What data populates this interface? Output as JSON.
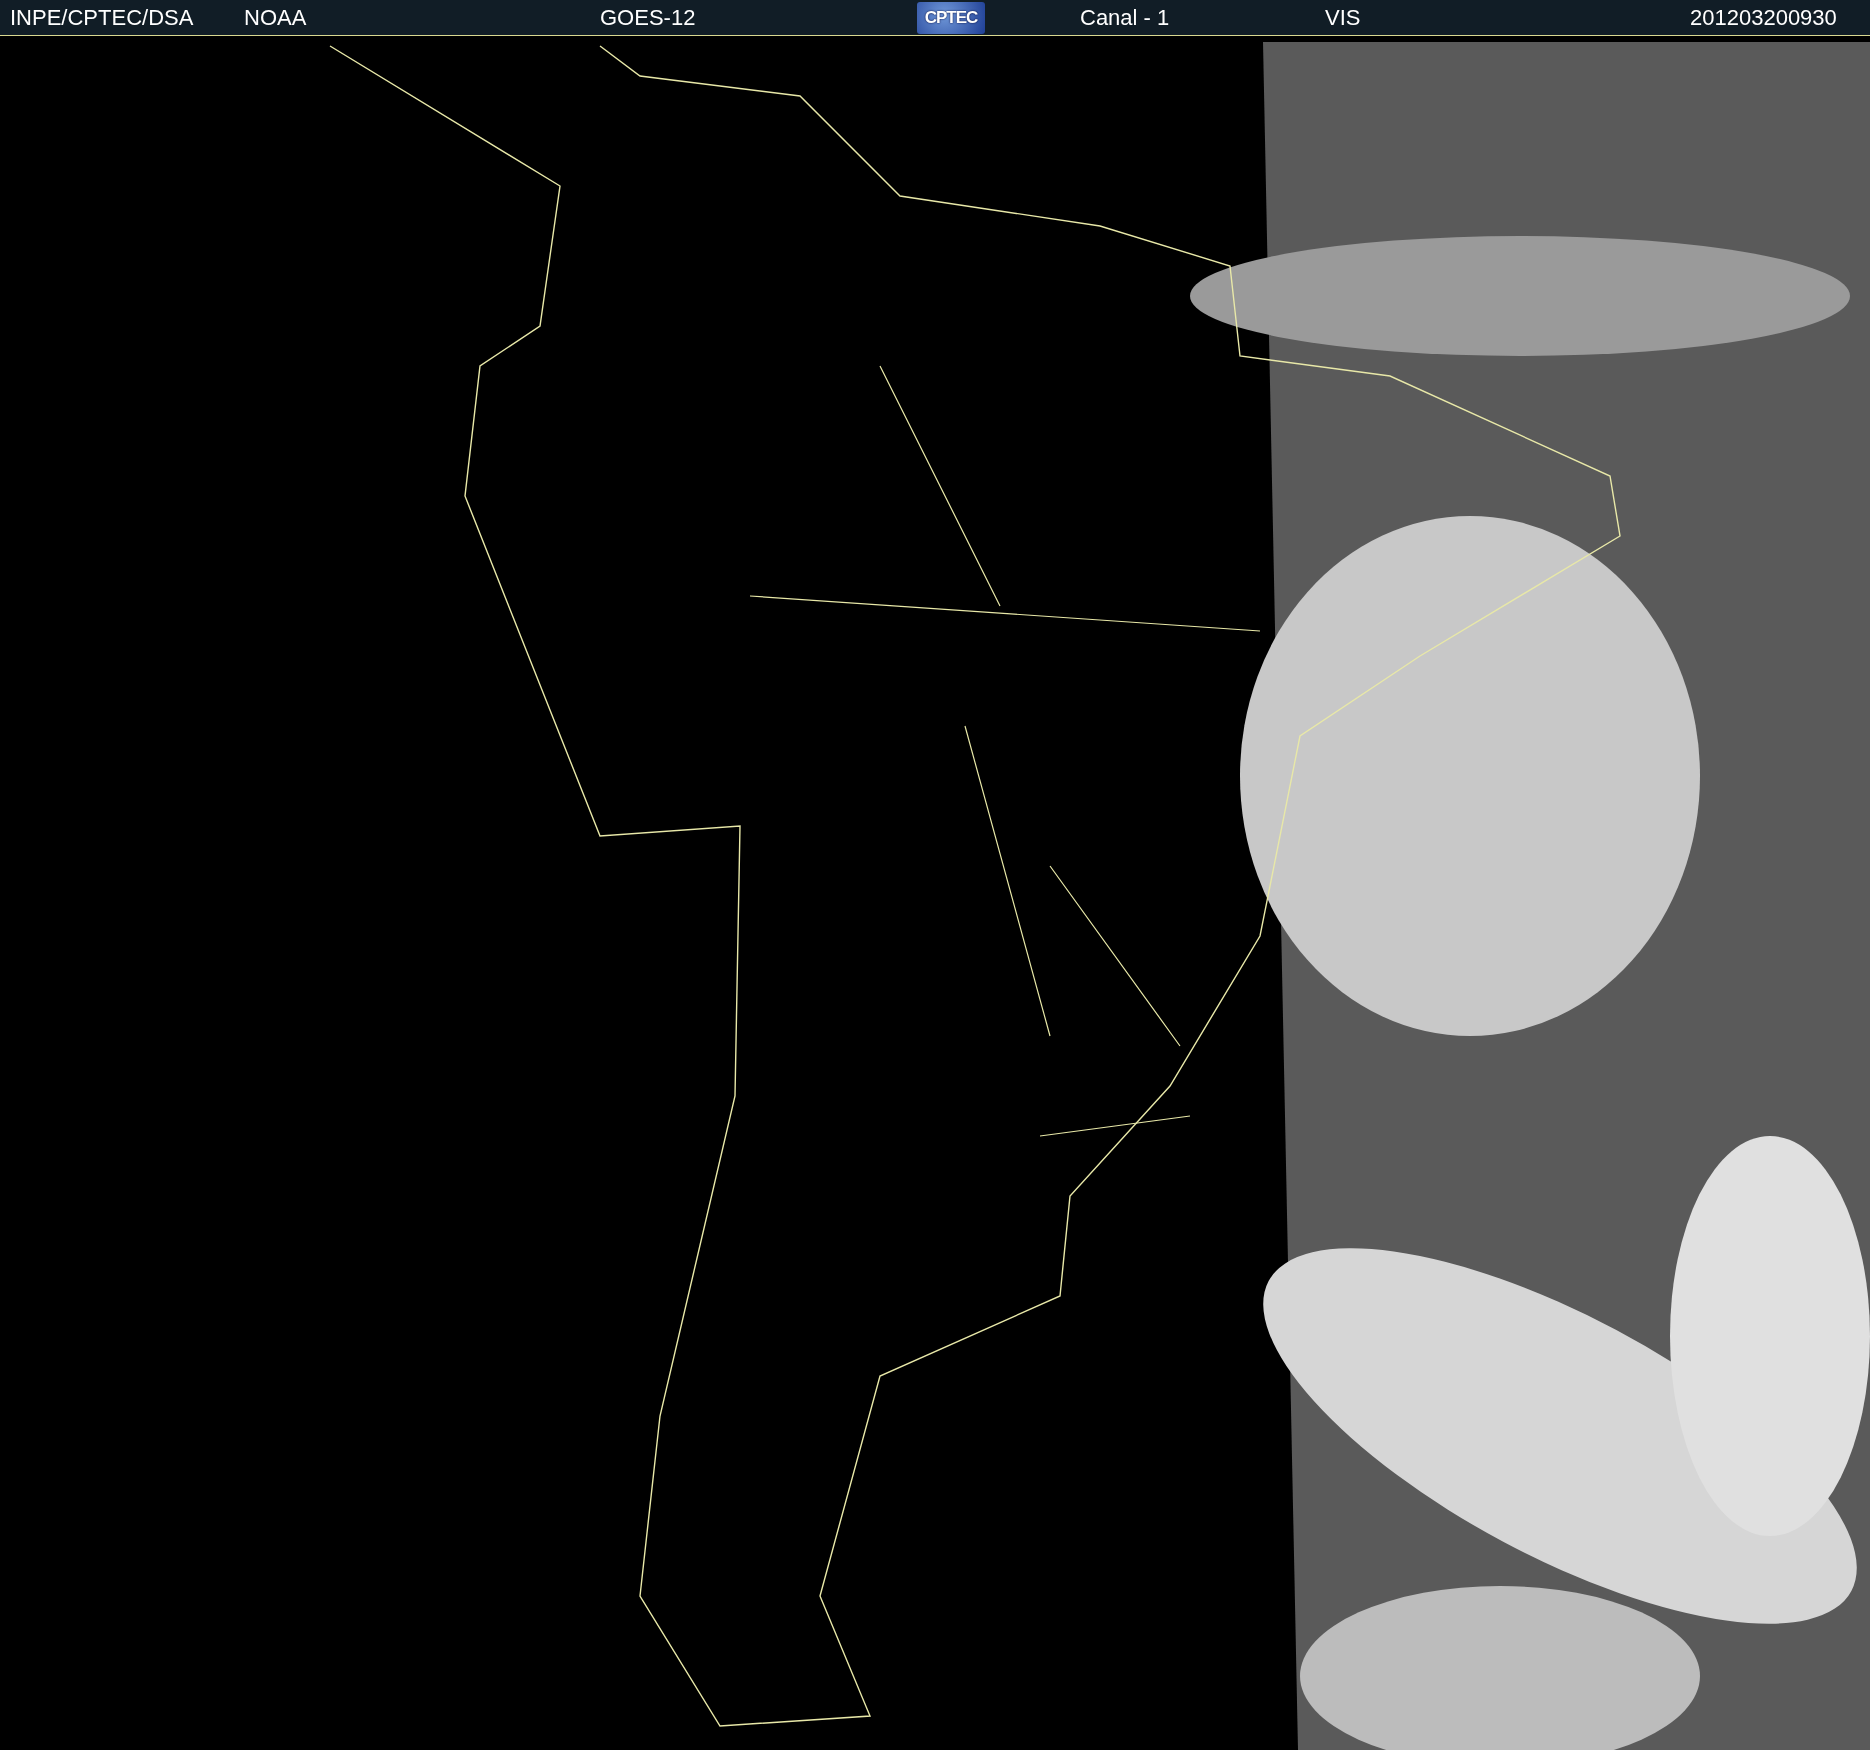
{
  "header": {
    "source": "INPE/CPTEC/DSA",
    "agency": "NOAA",
    "satellite": "GOES-12",
    "logo": "CPTEC",
    "channel": "Canal - 1",
    "band": "VIS",
    "timestamp": "201203200930"
  }
}
